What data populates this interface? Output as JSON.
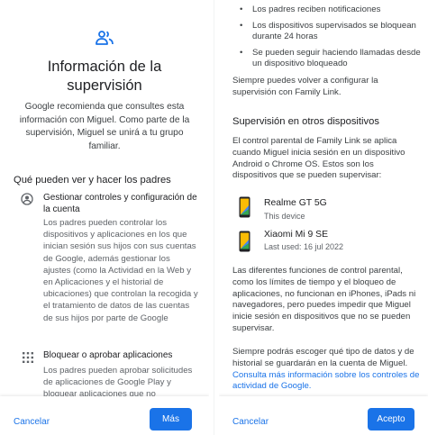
{
  "left": {
    "title": "Información de la supervisión",
    "intro": "Google recomienda que consultes esta información con Miguel. Como parte de la supervisión, Miguel se unirá a tu grupo familiar.",
    "section_heading": "Qué pueden ver y hacer los padres",
    "items": [
      {
        "icon": "account-circle-icon",
        "title": "Gestionar controles y configuración de la cuenta",
        "description": "Los padres pueden controlar los dispositivos y aplicaciones en los que inician sesión sus hijos con sus cuentas de Google, además gestionar los ajustes (como la Actividad en la Web y en Aplicaciones y el historial de ubicaciones) que controlan la recogida y el tratamiento de datos de las cuentas de sus hijos por parte de Google"
      },
      {
        "icon": "apps-grid-icon",
        "title": "Bloquear o aprobar aplicaciones",
        "description": "Los padres pueden aprobar solicitudes de aplicaciones de Google Play y bloquear aplicaciones que no"
      }
    ],
    "cancel_label": "Cancelar",
    "more_label": "Más"
  },
  "right": {
    "bullets": [
      "Los padres reciben notificaciones",
      "Los dispositivos supervisados se bloquean durante 24 horas",
      "Se pueden seguir haciendo llamadas desde un dispositivo bloqueado"
    ],
    "always_config": "Siempre puedes volver a configurar la supervisión con Family Link.",
    "other_heading": "Supervisión en otros dispositivos",
    "other_text": "El control parental de Family Link se aplica cuando Miguel inicia sesión en un dispositivo Android o Chrome OS. Estos son los dispositivos que se pueden supervisar:",
    "devices": [
      {
        "name": "Realme GT 5G",
        "status": "This device"
      },
      {
        "name": "Xiaomi Mi 9 SE",
        "status": "Last used: 16 jul 2022"
      }
    ],
    "limits_text": "Las diferentes funciones de control parental, como los límites de tiempo y el bloqueo de aplicaciones, no funcionan en iPhones, iPads ni navegadores, pero puedes impedir que Miguel inicie sesión en dispositivos que no se pueden supervisar.",
    "data_text": "Siempre podrás escoger qué tipo de datos y de historial se guardarán en la cuenta de Miguel.",
    "data_link": "Consulta más información sobre los controles de actividad de Google.",
    "cancel_label": "Cancelar",
    "accept_label": "Acepto"
  },
  "colors": {
    "accent": "#1a73e8",
    "text_primary": "#202124",
    "text_secondary": "#5f6368"
  }
}
